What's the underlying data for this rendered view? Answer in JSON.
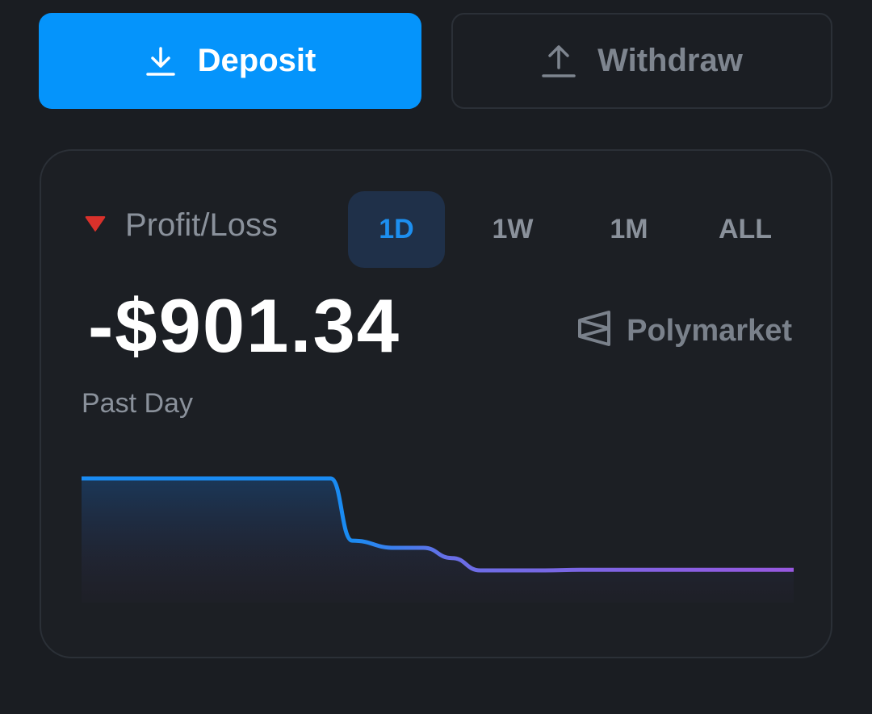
{
  "actions": {
    "deposit_label": "Deposit",
    "withdraw_label": "Withdraw",
    "deposit_icon": "download-icon",
    "withdraw_icon": "upload-icon",
    "deposit_color": "#0594fb"
  },
  "pnl": {
    "title": "Profit/Loss",
    "trend_icon": "triangle-down-icon",
    "trend_color": "#d9312b",
    "value": "-$901.34",
    "period_label": "Past Day",
    "ranges": [
      {
        "label": "1D",
        "active": true
      },
      {
        "label": "1W",
        "active": false
      },
      {
        "label": "1M",
        "active": false
      },
      {
        "label": "ALL",
        "active": false
      }
    ],
    "brand": {
      "name": "Polymarket",
      "icon": "polymarket-logo-icon"
    }
  },
  "chart_data": {
    "type": "area",
    "x": [
      0,
      0.35,
      0.38,
      0.44,
      0.48,
      0.52,
      0.56,
      0.65,
      0.7,
      1.0
    ],
    "values": [
      0,
      0,
      -610,
      -680,
      -680,
      -780,
      -901,
      -901,
      -895,
      -895
    ],
    "line_gradient": [
      "#1a8bf2",
      "#9858e0"
    ],
    "grid": false,
    "legend": "none"
  }
}
